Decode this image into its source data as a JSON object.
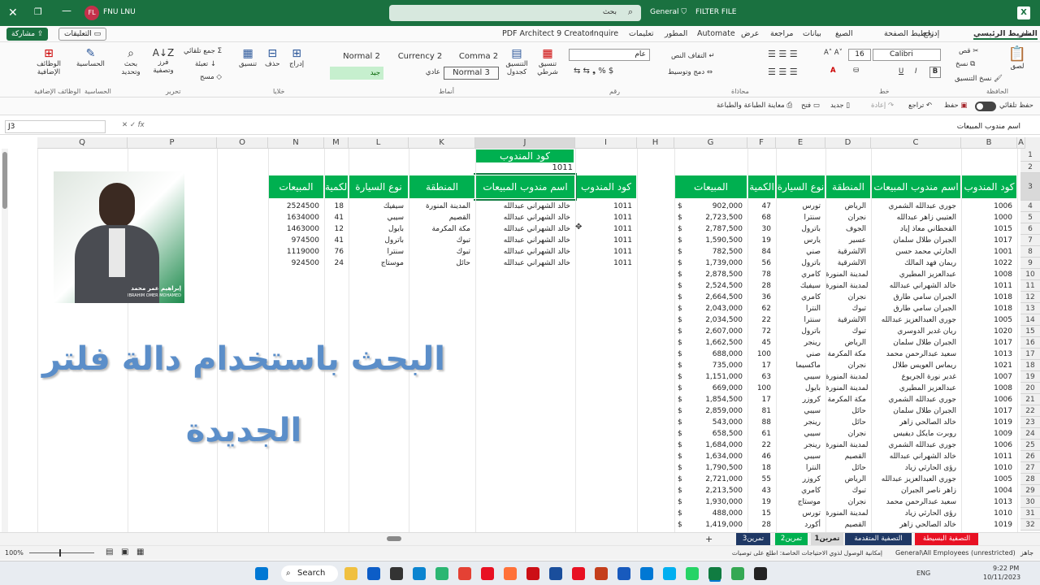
{
  "titlebar": {
    "search_placeholder": "بحث",
    "sensitivity": "General",
    "filter": "FILTER FILE",
    "user_initials": "FL",
    "user_name": "FNU LNU"
  },
  "ribbon_tabs": [
    "ملف",
    "الشريط الرئيسي",
    "إدراج",
    "تخطيط الصفحة",
    "الصيغ",
    "بيانات",
    "مراجعة",
    "عرض",
    "Automate",
    "المطور",
    "تعليمات",
    "Inquire",
    "PDF Architect 9 Creator"
  ],
  "ribbon_right_buttons": {
    "share": "مشاركة",
    "comments": "التعليقات"
  },
  "ribbon": {
    "font_name": "Calibri",
    "font_size": "16",
    "number_format": "عام",
    "styles": [
      "Normal 2",
      "Currency 2",
      "Comma 2",
      "جيد",
      "عادي",
      "Normal 3"
    ],
    "groups": [
      "الحافظة",
      "خط",
      "محاذاة",
      "رقم",
      "أنماط",
      "خلايا",
      "تحرير",
      "الحساسية",
      "الوظائف الإضافية"
    ],
    "clipboard": {
      "cut": "قص",
      "copy": "نسخ",
      "format": "نسخ التنسيق",
      "paste": "لصق"
    },
    "alignment": {
      "wrap": "التفاف النص",
      "merge": "دمج وتوسيط"
    },
    "styles_btns": {
      "cond": "تنسيق شرطي",
      "table": "التنسيق كجدول"
    },
    "cells": {
      "insert": "إدراج",
      "delete": "حذف",
      "format": "تنسيق"
    },
    "editing": {
      "sum": "جمع تلقائي",
      "fill": "تعبئة",
      "clear": "مسح",
      "sort": "فرز وتصفية",
      "find": "بحث وتحديد"
    },
    "sensitivity": "الحساسية",
    "addins": "الوظائف الإضافية"
  },
  "qat": {
    "autosave": "حفظ تلقائي",
    "save": "حفظ",
    "undo": "تراجع",
    "redo": "إعادة",
    "new": "جديد",
    "open": "فتح",
    "print": "معاينة الطباعة والطباعة"
  },
  "formula_bar": {
    "name_box": "J3",
    "fx": "fx",
    "content": "اسم مندوب المبيعات"
  },
  "columns": [
    "A",
    "B",
    "C",
    "D",
    "E",
    "F",
    "G",
    "H",
    "I",
    "J",
    "K",
    "L",
    "M",
    "N",
    "O",
    "P",
    "Q"
  ],
  "headers": {
    "code": "كود المندوب",
    "name": "اسم مندوب المبيعات",
    "region": "المنطقة",
    "car": "نوع السيارة",
    "qty": "الكمية",
    "sales": "المبيعات",
    "j1": "كود المندوب",
    "j2": "1011"
  },
  "left_table": [
    [
      "1006",
      "جوري عبدالله الشمري",
      "الرياض",
      "تورس",
      "47",
      "902,000"
    ],
    [
      "1000",
      "العتيبي زاهر عبدالله",
      "نجران",
      "سنترا",
      "68",
      "2,723,500"
    ],
    [
      "1015",
      "القحطاني معاذ إياد",
      "الجوف",
      "باترول",
      "30",
      "2,787,500"
    ],
    [
      "1017",
      "الجبران طلال سلمان",
      "عسير",
      "يارس",
      "19",
      "1,590,500"
    ],
    [
      "1001",
      "الحارثي محمد حسن",
      "الالشرقية",
      "صني",
      "84",
      "782,500"
    ],
    [
      "1022",
      "ريمان فهد المالك",
      "الالشرقية",
      "باترول",
      "56",
      "1,739,000"
    ],
    [
      "1008",
      "عبدالعزيز المطيري",
      "المدينة المنورة",
      "كامري",
      "78",
      "2,878,500"
    ],
    [
      "1011",
      "خالد الشهراني عبدالله",
      "المدينة المنورة",
      "سيفيك",
      "28",
      "2,524,500"
    ],
    [
      "1018",
      "الجبران سامي طارق",
      "نجران",
      "كامري",
      "36",
      "2,664,500"
    ],
    [
      "1018",
      "الجبران سامي طارق",
      "تبوك",
      "النترا",
      "62",
      "2,043,000"
    ],
    [
      "1005",
      "جوري العبدالعزيز عبدالله",
      "الالشرقية",
      "سنترا",
      "22",
      "2,034,500"
    ],
    [
      "1020",
      "ريان غدير الدوسري",
      "تبوك",
      "باترول",
      "72",
      "2,607,000"
    ],
    [
      "1017",
      "الجبران طلال سلمان",
      "الرياض",
      "رينجر",
      "45",
      "1,662,500"
    ],
    [
      "1013",
      "سعيد عبدالرحمن محمد",
      "مكة المكرمة",
      "صني",
      "100",
      "688,000"
    ],
    [
      "1021",
      "ريماس العويس طلال",
      "نجران",
      "ماكسيما",
      "17",
      "735,000"
    ],
    [
      "1007",
      "غدير نورة الجريوع",
      "المدينة المنورة",
      "سيبي",
      "63",
      "1,151,000"
    ],
    [
      "1008",
      "عبدالعزيز المطيري",
      "المدينة المنورة",
      "بايول",
      "100",
      "669,000"
    ],
    [
      "1006",
      "جوري عبدالله الشمري",
      "مكة المكرمة",
      "كروزر",
      "17",
      "1,854,500"
    ],
    [
      "1017",
      "الجبران طلال سلمان",
      "حائل",
      "سيبي",
      "81",
      "2,859,000"
    ],
    [
      "1019",
      "خالد الصالحي زاهر",
      "حائل",
      "رينجر",
      "88",
      "543,000"
    ],
    [
      "1009",
      "روبرت مايكل ديفيس",
      "نجران",
      "سيبي",
      "61",
      "658,500"
    ],
    [
      "1006",
      "جوري عبدالله الشمري",
      "المدينة المنورة",
      "رينجر",
      "22",
      "1,684,000"
    ],
    [
      "1011",
      "خالد الشهراني عبدالله",
      "القصيم",
      "سيبي",
      "46",
      "1,634,000"
    ],
    [
      "1010",
      "رؤى الحارثي زياد",
      "حائل",
      "النترا",
      "18",
      "1,790,500"
    ],
    [
      "1005",
      "جوري العبدالعزيز عبدالله",
      "الرياض",
      "كروزر",
      "55",
      "2,721,000"
    ],
    [
      "1004",
      "زاهر ناصر الجبران",
      "تبوك",
      "كامري",
      "43",
      "2,213,500"
    ],
    [
      "1013",
      "سعيد عبدالرحمن محمد",
      "نجران",
      "موستاج",
      "19",
      "1,930,000"
    ],
    [
      "1010",
      "رؤى الحارثي زياد",
      "المدينة المنورة",
      "تورس",
      "15",
      "488,000"
    ],
    [
      "1019",
      "خالد الصالحي زاهر",
      "القصيم",
      "أكورد",
      "28",
      "1,419,000"
    ]
  ],
  "right_table": [
    [
      "1011",
      "خالد الشهراني عبدالله",
      "المدينة المنورة",
      "سيفيك",
      "18",
      "2524500"
    ],
    [
      "1011",
      "خالد الشهراني عبدالله",
      "القصيم",
      "سيبي",
      "41",
      "1634000"
    ],
    [
      "1011",
      "خالد الشهراني عبدالله",
      "مكة المكرمة",
      "بايول",
      "12",
      "1463000"
    ],
    [
      "1011",
      "خالد الشهراني عبدالله",
      "تبوك",
      "باترول",
      "41",
      "974500"
    ],
    [
      "1011",
      "خالد الشهراني عبدالله",
      "تبوك",
      "سنترا",
      "76",
      "1119000"
    ],
    [
      "1011",
      "خالد الشهراني عبدالله",
      "حائل",
      "موستاج",
      "24",
      "924500"
    ]
  ],
  "currency_symbol": "$",
  "photo_caption": {
    "ar": "إبراهيم عمر محمد",
    "en": "IBRAHIM OMER MOHAMED"
  },
  "overlay_title": {
    "line1": "البحث  باستخدام دالة فلتر",
    "line2": "الجديدة"
  },
  "sheet_tabs": [
    "التصفية البسيطة",
    "التصفية المتقدمة",
    "تمرين1",
    "تمرين2",
    "تمرين3"
  ],
  "sheet_tab_colors": [
    "#e81123",
    "#1f3864",
    "#d9d9d9",
    "#00b050",
    "#1f3864"
  ],
  "status": {
    "ready": "جاهز",
    "accessibility": "إمكانية الوصول لذوي الاحتياجات الخاصة: اطلع على توصيات",
    "sensitivity": "General\\All Employees (unrestricted)",
    "zoom": "100%"
  },
  "taskbar": {
    "search": "Search",
    "lang": "ENG",
    "time": "9:22 PM",
    "date": "10/11/2023"
  }
}
